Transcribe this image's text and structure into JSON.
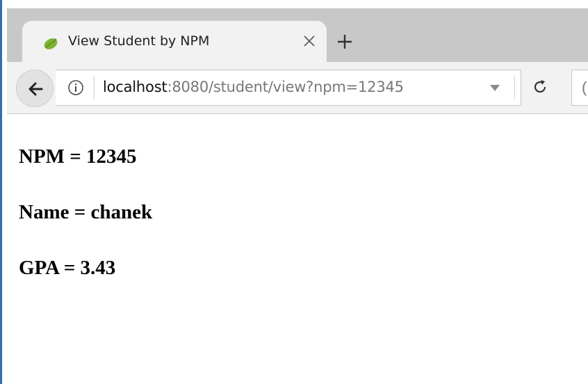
{
  "browser": {
    "tab": {
      "title": "View Student by NPM",
      "favicon": "spring-leaf-icon",
      "close_icon": "close-icon"
    },
    "new_tab_icon": "plus-icon",
    "address_bar": {
      "host": "localhost",
      "rest": ":8080/student/view?npm=12345",
      "info_icon": "info-icon"
    },
    "back_icon": "back-arrow-icon",
    "reload_icon": "reload-icon",
    "colors": {
      "tab_strip": "#c8c8c8",
      "active_tab": "#f2f2f2",
      "favicon_green": "#7db233"
    }
  },
  "student": {
    "npm_line": "NPM = 12345",
    "name_line": "Name = chanek",
    "gpa_line": "GPA = 3.43"
  }
}
